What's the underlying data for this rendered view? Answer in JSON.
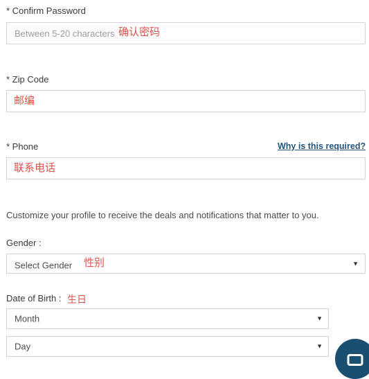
{
  "form": {
    "confirm_password": {
      "label": "* Confirm Password",
      "placeholder": "Between 5-20 characters",
      "value": "",
      "annotation": "确认密码"
    },
    "zip_code": {
      "label": "* Zip Code",
      "placeholder": "",
      "value": "",
      "annotation": "邮编"
    },
    "phone": {
      "label": "* Phone",
      "help_link": "Why is this required?",
      "placeholder": "",
      "value": "",
      "annotation": "联系电话"
    },
    "profile_note": "Customize your profile to receive the deals and notifications that matter to you.",
    "gender": {
      "label": "Gender :",
      "selected": "Select Gender",
      "annotation": "性别",
      "arrow": "▼"
    },
    "date_of_birth": {
      "label": "Date of Birth :",
      "annotation": "生日",
      "month": {
        "selected": "Month",
        "arrow": "▼"
      },
      "day": {
        "selected": "Day",
        "arrow": "▼"
      }
    }
  },
  "chat_widget": {
    "icon": "chat-bubble-icon"
  },
  "colors": {
    "annotation_red": "#e0524b",
    "link_blue": "#24547d",
    "fab_blue": "#1b4f72",
    "border_gray": "#d4d4d4"
  }
}
